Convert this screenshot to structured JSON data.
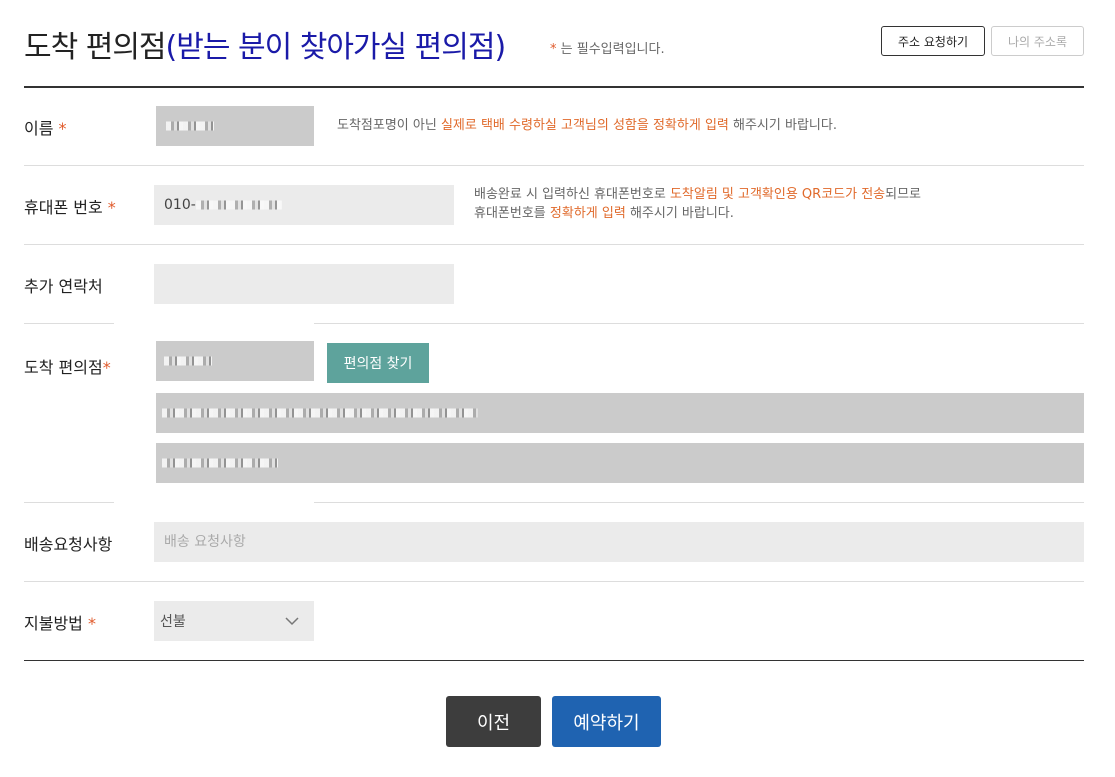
{
  "header": {
    "title": "도착 편의점",
    "subtitle": "(받는 분이 찾아가실 편의점)",
    "required_star": "*",
    "required_note": "는 필수입력입니다.",
    "address_request_label": "주소 요청하기",
    "address_book_label": "나의 주소록"
  },
  "form": {
    "name": {
      "label": "이름",
      "star": "*",
      "help_pre": "도착점포명이 아닌 ",
      "help_highlight": "실제로 택배 수령하실 고객님의 성함을 정확하게 입력",
      "help_post": " 해주시기 바랍니다."
    },
    "phone": {
      "label": "휴대폰 번호",
      "star": "*",
      "value_prefix": "010-",
      "help_line1_pre": "배송완료 시 입력하신 휴대폰번호로 ",
      "help_line1_highlight": "도착알림 및 고객확인용 QR코드가 전송",
      "help_line1_post": "되므로",
      "help_line2_pre": "휴대폰번호를 ",
      "help_line2_highlight": "정확하게 입력",
      "help_line2_post": " 해주시기 바랍니다."
    },
    "extra_contact": {
      "label": "추가 연락처",
      "value": ""
    },
    "store": {
      "label": "도착 편의점",
      "star": "*",
      "find_button": "편의점 찾기"
    },
    "delivery_request": {
      "label": "배송요청사항",
      "placeholder": "배송 요청사항"
    },
    "payment": {
      "label": "지불방법",
      "star": "*",
      "selected": "선불"
    }
  },
  "actions": {
    "prev_label": "이전",
    "reserve_label": "예약하기"
  },
  "colors": {
    "accent_blue": "#1f63b1",
    "highlight_orange": "#e06a2b",
    "find_button_teal": "#5ea39c",
    "title_blue": "#1a1aa8"
  }
}
